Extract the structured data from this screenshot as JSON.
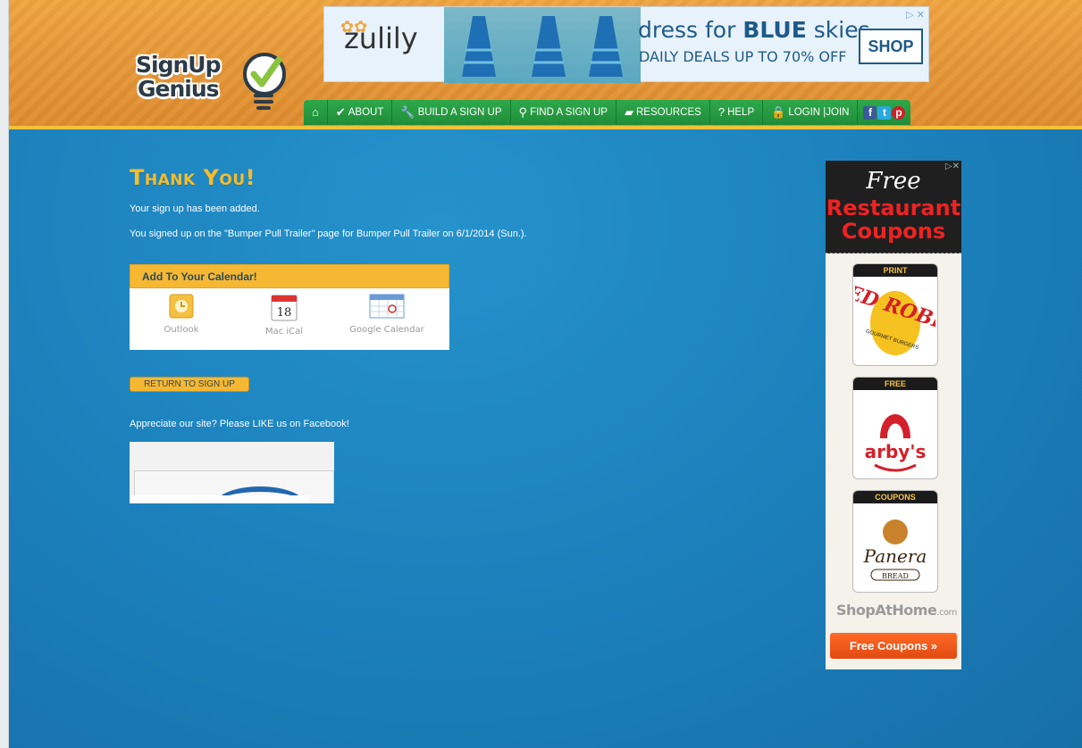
{
  "logo": {
    "line1": "SignUp",
    "line2": "Genius"
  },
  "banner": {
    "brand": "zulily",
    "headline_pre": "dress for ",
    "headline_bold": "BLUE",
    "headline_post": " skies",
    "subline": "DAILY DEALS UP TO 70% OFF",
    "cta": "SHOP",
    "adchoice": "▷ ✕"
  },
  "nav": {
    "items": [
      {
        "label": "ABOUT",
        "icon": "check-icon"
      },
      {
        "label": "BUILD A SIGN UP",
        "icon": "wrench-icon"
      },
      {
        "label": "FIND A SIGN UP",
        "icon": "magnifier-icon"
      },
      {
        "label": "RESOURCES",
        "icon": "folder-icon"
      },
      {
        "label": "HELP",
        "icon": "question-icon"
      },
      {
        "label": "LOGIN  |JOIN",
        "icon": "lock-icon"
      }
    ],
    "social": [
      "f",
      "t",
      "p"
    ]
  },
  "main": {
    "title": "Thank You!",
    "message1": "Your sign up has been added.",
    "message2": "You signed up on the \"Bumper Pull Trailer\" page for Bumper Pull Trailer on 6/1/2014 (Sun.).",
    "calendar": {
      "header": "Add To Your Calendar!",
      "options": [
        "Outlook",
        "Mac iCal",
        "Google Calendar"
      ],
      "ical_day": "18"
    },
    "return_button": "RETURN TO SIGN UP",
    "facebook_text": "Appreciate our site? Please LIKE us on Facebook!"
  },
  "side_ad": {
    "adchoice": "▷✕",
    "free": "Free",
    "restaurant": "Restaurant",
    "coupons": "Coupons",
    "labels": [
      "PRINT",
      "FREE",
      "COUPONS"
    ],
    "brand1": "RED ROBIN",
    "brand1_sub": "GOURMET BURGERS",
    "brand2": "arby's",
    "brand3": "Panera",
    "brand3_sub": "BREAD",
    "shopathome": "ShopAtHome",
    "shopathome_suffix": ".com",
    "cta": "Free Coupons »"
  },
  "colors": {
    "page_bg": "#1f86c1",
    "title": "#f7bd2a",
    "nav_green": "#1f8d3a",
    "header_orange": "#e89a3a"
  }
}
